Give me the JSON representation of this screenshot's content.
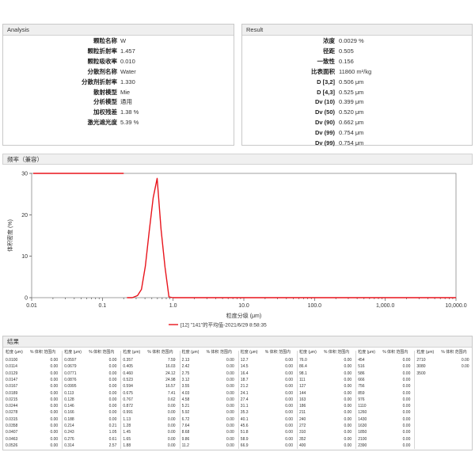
{
  "analysis": {
    "title": "Analysis",
    "rows": [
      {
        "label": "颗粒名称",
        "value": "W"
      },
      {
        "label": "颗粒折射率",
        "value": "1.457"
      },
      {
        "label": "颗粒吸收率",
        "value": "0.010"
      },
      {
        "label": "分散剂名称",
        "value": "Water"
      },
      {
        "label": "分散剂折射率",
        "value": "1.330"
      },
      {
        "label": "散射模型",
        "value": "Mie"
      },
      {
        "label": "分析模型",
        "value": "通用"
      },
      {
        "label": "加权残差",
        "value": "1.38 %"
      },
      {
        "label": "激光遮光度",
        "value": "5.39 %"
      }
    ]
  },
  "result": {
    "title": "Result",
    "rows": [
      {
        "label": "浓度",
        "value": "0.0029 %"
      },
      {
        "label": "径距",
        "value": "0.505"
      },
      {
        "label": "一致性",
        "value": "0.156"
      },
      {
        "label": "比表面积",
        "value": "11860 m²/kg"
      },
      {
        "label": "D [3,2]",
        "value": "0.506 μm"
      },
      {
        "label": "D [4,3]",
        "value": "0.525 μm"
      },
      {
        "label": "Dv (10)",
        "value": "0.399 μm"
      },
      {
        "label": "Dv (50)",
        "value": "0.520 μm"
      },
      {
        "label": "Dv (90)",
        "value": "0.662 μm"
      },
      {
        "label": "Dv (99)",
        "value": "0.754 μm"
      },
      {
        "label": "Dv (99)",
        "value": "0.754 μm"
      }
    ]
  },
  "chart_panel": {
    "title": "频率（兼容）"
  },
  "chart_data": {
    "type": "line",
    "title": "",
    "xlabel": "粒度分级 (μm)",
    "ylabel": "体积密度 (%)",
    "x_scale": "log",
    "xlim": [
      0.01,
      10000
    ],
    "ylim": [
      0,
      30
    ],
    "x_ticks": [
      {
        "value": 0.01,
        "label": "0.01"
      },
      {
        "value": 0.1,
        "label": "0.1"
      },
      {
        "value": 1,
        "label": "1.0"
      },
      {
        "value": 10,
        "label": "10.0"
      },
      {
        "value": 100,
        "label": "100.0"
      },
      {
        "value": 1000,
        "label": "1,000.0"
      },
      {
        "value": 10000,
        "label": "10,000.0"
      }
    ],
    "y_ticks": [
      {
        "value": 0,
        "label": "0"
      },
      {
        "value": 10,
        "label": "10"
      },
      {
        "value": 20,
        "label": "20"
      },
      {
        "value": 30,
        "label": "30"
      }
    ],
    "legend_position": "bottom-center",
    "series": [
      {
        "name": "[12] \"141\"的平均值-2021/6/29 8:58:35",
        "color": "#e8141c",
        "x": [
          0.223,
          0.265,
          0.314,
          0.357,
          0.405,
          0.46,
          0.523,
          0.594,
          0.675,
          0.767,
          0.872,
          0.991,
          1.13,
          10000
        ],
        "y": [
          0,
          0,
          0.5,
          2.0,
          7.59,
          16.03,
          24.12,
          28.8,
          16.57,
          7.41,
          0.2,
          0,
          0,
          0
        ]
      }
    ],
    "legend_swatch_line": {
      "x": [
        0.01,
        0.2
      ],
      "y": [
        30,
        30
      ]
    }
  },
  "results_table": {
    "title": "结果",
    "col_size_header": "粒度 (μm)",
    "col_pct_header": "% 体积 范围内",
    "blocks": [
      {
        "sizes": [
          "0.0100",
          "0.0114",
          "0.0129",
          "0.0147",
          "0.0167",
          "0.0189",
          "0.0215",
          "0.0244",
          "0.0278",
          "0.0315",
          "0.0358",
          "0.0407",
          "0.0463",
          "0.0526"
        ],
        "pcts": [
          "0.00",
          "0.00",
          "0.00",
          "0.00",
          "0.00",
          "0.00",
          "0.00",
          "0.00",
          "0.00",
          "0.00",
          "0.00",
          "0.00",
          "0.00",
          "0.00"
        ]
      },
      {
        "sizes": [
          "0.0597",
          "0.0679",
          "0.0771",
          "0.0876",
          "0.0995",
          "0.113",
          "0.128",
          "0.146",
          "0.166",
          "0.188",
          "0.214",
          "0.243",
          "0.276",
          "0.314"
        ],
        "pcts": [
          "0.00",
          "0.00",
          "0.00",
          "0.00",
          "0.00",
          "0.00",
          "0.00",
          "0.00",
          "0.00",
          "0.00",
          "0.21",
          "1.05",
          "0.61",
          "2.57"
        ]
      },
      {
        "sizes": [
          "0.357",
          "0.405",
          "0.460",
          "0.523",
          "0.594",
          "0.675",
          "0.767",
          "0.872",
          "0.991",
          "1.13",
          "1.28",
          "1.45",
          "1.65",
          "1.88"
        ],
        "pcts": [
          "7.59",
          "16.03",
          "24.12",
          "24.98",
          "16.57",
          "7.41",
          "0.62",
          "0.00",
          "0.00",
          "0.00",
          "0.00",
          "0.00",
          "0.00",
          "0.00"
        ]
      },
      {
        "sizes": [
          "2.13",
          "2.42",
          "2.75",
          "3.12",
          "3.55",
          "4.03",
          "4.58",
          "5.21",
          "5.92",
          "6.72",
          "7.64",
          "8.68",
          "9.86",
          "11.2"
        ],
        "pcts": [
          "0.00",
          "0.00",
          "0.00",
          "0.00",
          "0.00",
          "0.00",
          "0.00",
          "0.00",
          "0.00",
          "0.00",
          "0.00",
          "0.00",
          "0.00",
          "0.00"
        ]
      },
      {
        "sizes": [
          "12.7",
          "14.5",
          "16.4",
          "18.7",
          "21.2",
          "24.1",
          "27.4",
          "31.1",
          "35.3",
          "40.1",
          "45.6",
          "51.8",
          "58.9",
          "66.9"
        ],
        "pcts": [
          "0.00",
          "0.00",
          "0.00",
          "0.00",
          "0.00",
          "0.00",
          "0.00",
          "0.00",
          "0.00",
          "0.00",
          "0.00",
          "0.00",
          "0.00",
          "0.00"
        ]
      },
      {
        "sizes": [
          "76.0",
          "86.4",
          "98.1",
          "111",
          "127",
          "144",
          "163",
          "186",
          "211",
          "240",
          "272",
          "310",
          "352",
          "400"
        ],
        "pcts": [
          "0.00",
          "0.00",
          "0.00",
          "0.00",
          "0.00",
          "0.00",
          "0.00",
          "0.00",
          "0.00",
          "0.00",
          "0.00",
          "0.00",
          "0.00",
          "0.00"
        ]
      },
      {
        "sizes": [
          "454",
          "516",
          "586",
          "666",
          "756",
          "859",
          "976",
          "1110",
          "1260",
          "1430",
          "1630",
          "1850",
          "2100",
          "2390"
        ],
        "pcts": [
          "0.00",
          "0.00",
          "0.00",
          "0.00",
          "0.00",
          "0.00",
          "0.00",
          "0.00",
          "0.00",
          "0.00",
          "0.00",
          "0.00",
          "0.00",
          "0.00"
        ]
      },
      {
        "sizes": [
          "2710",
          "3080",
          "3500"
        ],
        "pcts": [
          "0.00",
          "0.00",
          ""
        ]
      }
    ]
  }
}
